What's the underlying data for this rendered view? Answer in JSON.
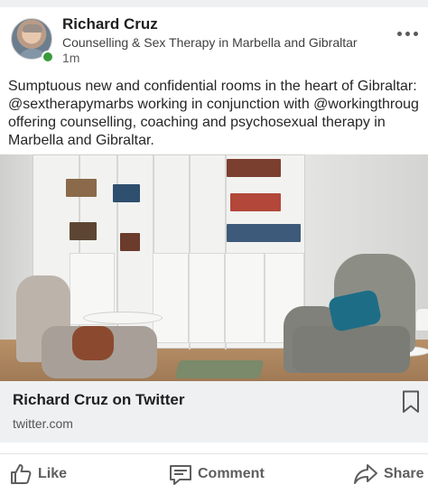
{
  "post": {
    "author": {
      "name": "Richard Cruz",
      "headline": "Counselling & Sex Therapy in Marbella and Gibraltar",
      "time": "1m",
      "online": true
    },
    "body_text": "Sumptuous new and confidential rooms in the heart of Gibraltar: @sextherapymarbs working in conjunction with @workingthroug offering counselling, coaching and psychosexual therapy in Marbella and Gibraltar.",
    "link_card": {
      "title": "Richard Cruz on Twitter",
      "domain": "twitter.com"
    }
  },
  "actions": {
    "like_label": "Like",
    "comment_label": "Comment",
    "share_label": "Share"
  },
  "icons": {
    "more": "more-horizontal-icon",
    "bookmark": "bookmark-icon",
    "like": "thumbs-up-icon",
    "comment": "comment-icon",
    "share": "share-arrow-icon"
  },
  "colors": {
    "online_indicator": "#3a9a3a",
    "card_background": "#eef0f2",
    "action_text": "#5e5e5e"
  }
}
